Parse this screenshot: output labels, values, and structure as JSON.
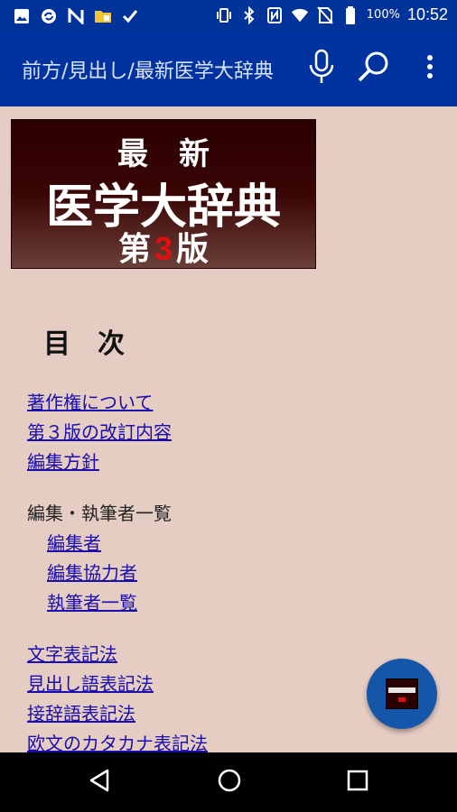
{
  "status_bar": {
    "battery_text": "100%",
    "time": "10:52",
    "icons_left": [
      "image-icon",
      "sync-icon",
      "n-icon",
      "folder-icon",
      "check-flag-icon"
    ],
    "icons_right": [
      "vibrate-icon",
      "bluetooth-icon",
      "nfc-icon",
      "wifi-icon",
      "no-sim-icon",
      "battery-icon"
    ]
  },
  "app_bar": {
    "title": "前方/見出し/最新医学大辞典",
    "background": "#0033a0"
  },
  "cover": {
    "line1": "最新",
    "line2": "医学大辞典",
    "line3_pre": "第",
    "line3_num": "3",
    "line3_post": "版"
  },
  "toc": {
    "heading": "目次",
    "group1": [
      "著作権について",
      "第３版の改訂内容",
      "編集方針"
    ],
    "group2_label": "編集・執筆者一覧",
    "group2": [
      "編集者",
      "編集協力者",
      "執筆者一覧"
    ],
    "group3": [
      "文字表記法",
      "見出し語表記法",
      "接辞語表記法",
      "欧文のカタカナ表記法"
    ]
  },
  "colors": {
    "link": "#1a0dab",
    "page_bg": "#e6cdc4",
    "fab": "#1656a8"
  }
}
